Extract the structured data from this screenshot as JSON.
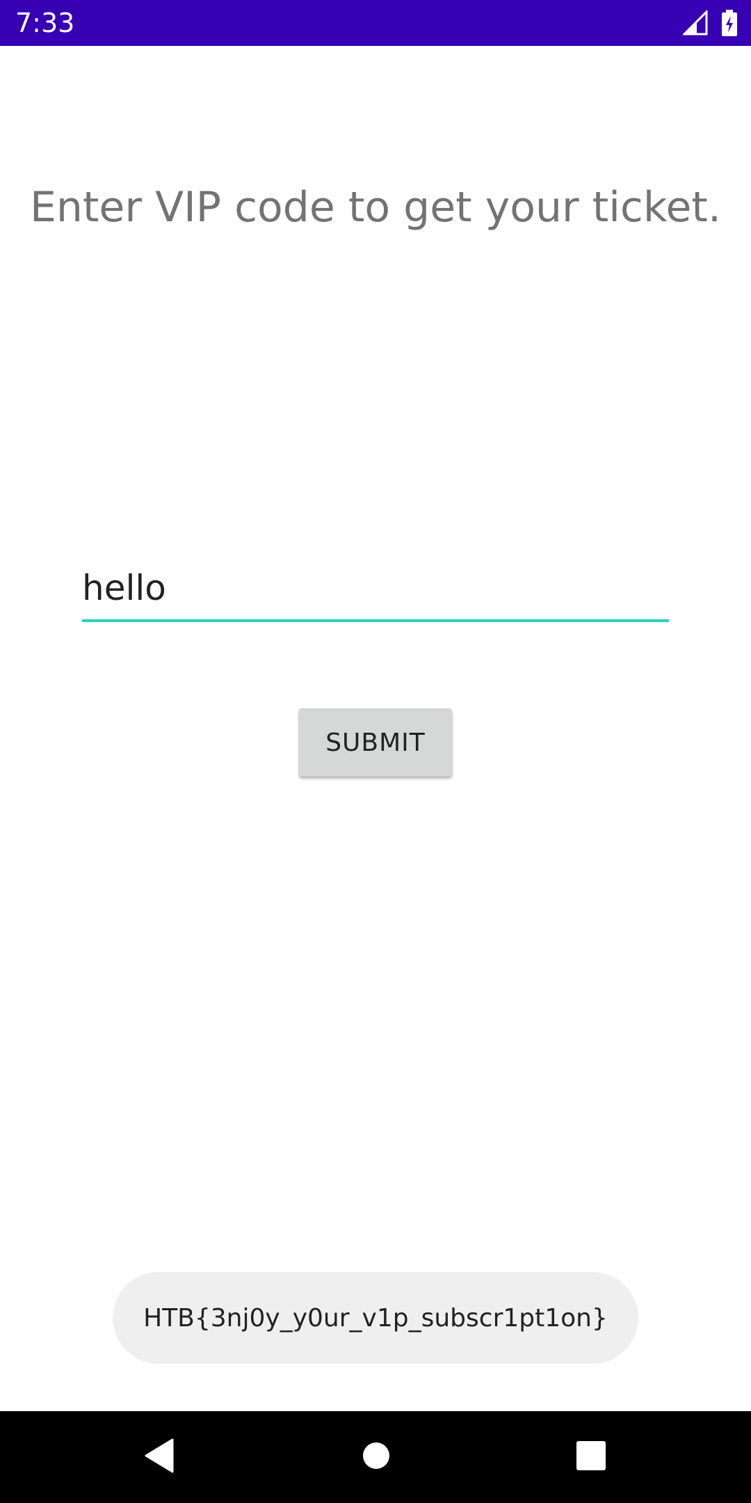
{
  "status_bar": {
    "time": "7:33",
    "background_color": "#3700b3",
    "icons": [
      "signal-icon",
      "battery-charging-icon"
    ]
  },
  "main": {
    "heading": "Enter VIP code to get your ticket.",
    "input": {
      "value": "hello",
      "underline_color": "#26d0c3"
    },
    "submit_label": "SUBMIT"
  },
  "toast": {
    "message": "HTB{3nj0y_y0ur_v1p_subscr1pt1on}"
  },
  "nav_bar": {
    "buttons": [
      "back-icon",
      "home-icon",
      "recents-icon"
    ]
  }
}
